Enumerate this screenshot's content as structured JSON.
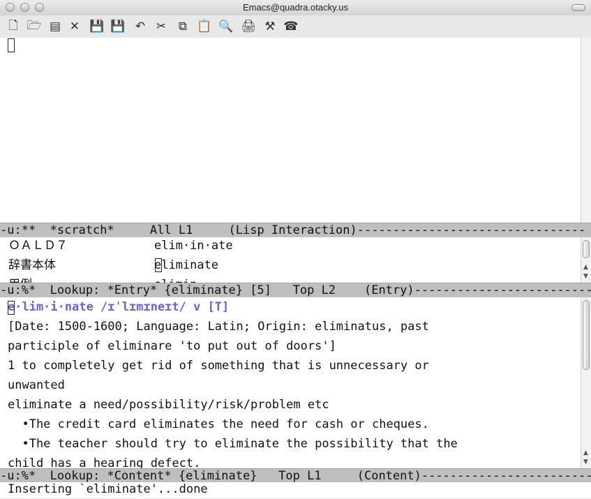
{
  "window": {
    "title": "Emacs@quadra.otacky.us"
  },
  "toolbar": {
    "icons": [
      "new-file-icon",
      "open-folder-icon",
      "dired-icon",
      "close-icon",
      "save-icon",
      "save-as-icon",
      "undo-icon",
      "cut-icon",
      "copy-icon",
      "paste-icon",
      "search-icon",
      "print-icon",
      "preferences-icon",
      "help-icon"
    ]
  },
  "modelines": {
    "scratch": "-u:**  *scratch*     All L1     (Lisp Interaction)--------------------------------",
    "entry": "-u:%*  Lookup: *Entry* {eliminate} [5]   Top L2    (Entry)--------------------------",
    "content": "-u:%*  Lookup: *Content* {eliminate}   Top L1     (Content)-------------------------"
  },
  "entry_pane": {
    "rows": [
      {
        "dict": "ＯＡＬＤ７",
        "word": "elim·in·ate"
      },
      {
        "dict": "辞書本体",
        "word": "eliminate"
      },
      {
        "dict": "用例",
        "word": "elimin..."
      }
    ]
  },
  "content_pane": {
    "headword": "e·lim·i·nate /ɪˈlɪmɪneɪt/ v [T]",
    "lines": [
      "[Date: 1500-1600; Language: Latin; Origin: eliminatus, past",
      "participle of eliminare 'to put out of doors']",
      "1 to completely get rid of something that is unnecessary or",
      "unwanted",
      "eliminate a need/possibility/risk/problem etc",
      "  •The credit card eliminates the need for cash or cheques.",
      "  •The teacher should try to eliminate the possibility that the",
      "child has a hearing defect."
    ]
  },
  "echo_area": "Inserting `eliminate'...done"
}
